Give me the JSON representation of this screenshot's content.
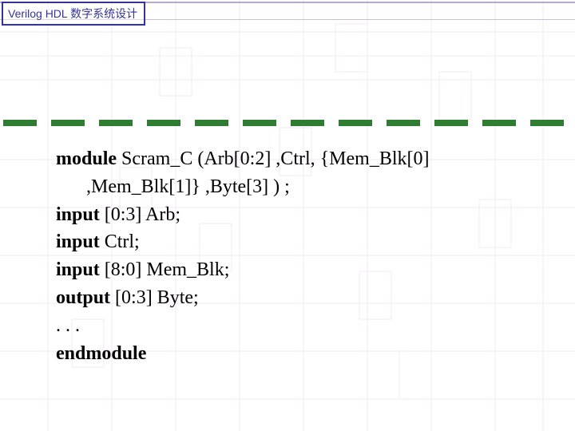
{
  "header": {
    "tab": "Verilog HDL 数字系统设计"
  },
  "code": {
    "l1_kw": "module",
    "l1_rest": " Scram_C (Arb[0:2] ,Ctrl, {Mem_Blk[0]",
    "l2": ",Mem_Blk[1]} ,Byte[3] ) ;",
    "l3_kw": "input",
    "l3_rest": " [0:3] Arb;",
    "l4_kw": "input",
    "l4_rest": " Ctrl;",
    "l5_kw": "input",
    "l5_rest": " [8:0] Mem_Blk;",
    "l6_kw": "output",
    "l6_rest": " [0:3] Byte;",
    "l7": ". . .",
    "l8_kw": "endmodule"
  }
}
